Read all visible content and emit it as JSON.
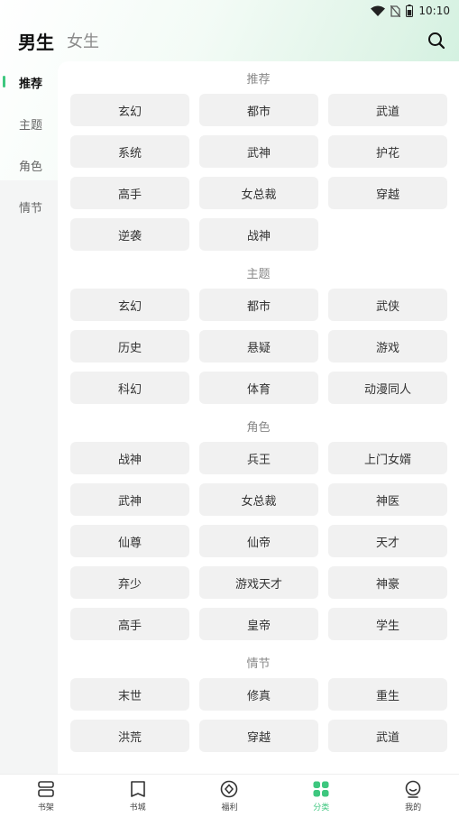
{
  "status_bar": {
    "time": "10:10",
    "icons": [
      "wifi-icon",
      "no-sim-icon",
      "battery-icon"
    ]
  },
  "header": {
    "tabs": [
      {
        "label": "男生",
        "active": true
      },
      {
        "label": "女生",
        "active": false
      }
    ],
    "search_icon": "search-icon"
  },
  "sidebar": {
    "items": [
      {
        "label": "推荐",
        "active": true
      },
      {
        "label": "主题",
        "active": false
      },
      {
        "label": "角色",
        "active": false
      },
      {
        "label": "情节",
        "active": false
      }
    ]
  },
  "sections": [
    {
      "title": "推荐",
      "tags": [
        "玄幻",
        "都市",
        "武道",
        "系统",
        "武神",
        "护花",
        "高手",
        "女总裁",
        "穿越",
        "逆袭",
        "战神"
      ]
    },
    {
      "title": "主题",
      "tags": [
        "玄幻",
        "都市",
        "武侠",
        "历史",
        "悬疑",
        "游戏",
        "科幻",
        "体育",
        "动漫同人"
      ]
    },
    {
      "title": "角色",
      "tags": [
        "战神",
        "兵王",
        "上门女婿",
        "武神",
        "女总裁",
        "神医",
        "仙尊",
        "仙帝",
        "天才",
        "弃少",
        "游戏天才",
        "神豪",
        "高手",
        "皇帝",
        "学生"
      ]
    },
    {
      "title": "情节",
      "tags": [
        "末世",
        "修真",
        "重生",
        "洪荒",
        "穿越",
        "武道"
      ]
    }
  ],
  "bottom_nav": [
    {
      "label": "书架",
      "icon": "bookshelf-icon",
      "active": false
    },
    {
      "label": "书城",
      "icon": "book-icon",
      "active": false
    },
    {
      "label": "福利",
      "icon": "gift-icon",
      "active": false
    },
    {
      "label": "分类",
      "icon": "category-icon",
      "active": true
    },
    {
      "label": "我的",
      "icon": "profile-icon",
      "active": false
    }
  ],
  "colors": {
    "accent": "#3ec77f",
    "tag_bg": "#f1f1f1",
    "page_bg": "#f4f5f5"
  }
}
